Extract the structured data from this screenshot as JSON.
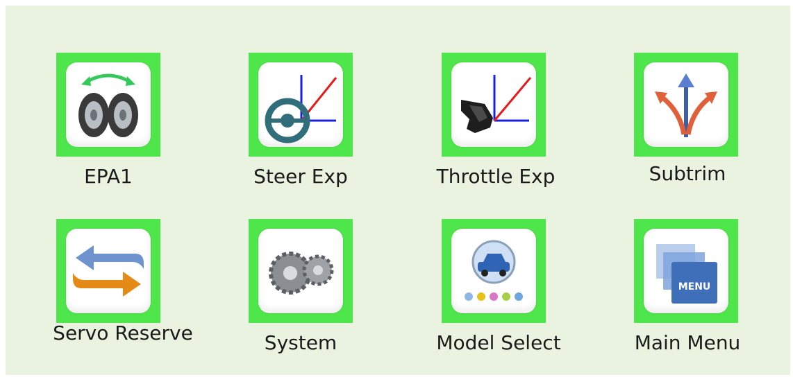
{
  "menu": {
    "items": [
      {
        "label": "EPA1",
        "icon": "tires-icon"
      },
      {
        "label": "Steer Exp",
        "icon": "steering-wheel-curve-icon"
      },
      {
        "label": "Throttle Exp",
        "icon": "throttle-curve-icon"
      },
      {
        "label": "Subtrim",
        "icon": "arrows-split-icon"
      },
      {
        "label": "Servo Reserve",
        "icon": "reverse-arrows-icon"
      },
      {
        "label": "System",
        "icon": "gears-icon"
      },
      {
        "label": "Model Select",
        "icon": "car-select-icon"
      },
      {
        "label": "Main Menu",
        "icon": "menu-folders-icon"
      }
    ]
  },
  "colors": {
    "background": "#e9f3df",
    "tile": "#4ee64a",
    "card": "#ffffff"
  }
}
